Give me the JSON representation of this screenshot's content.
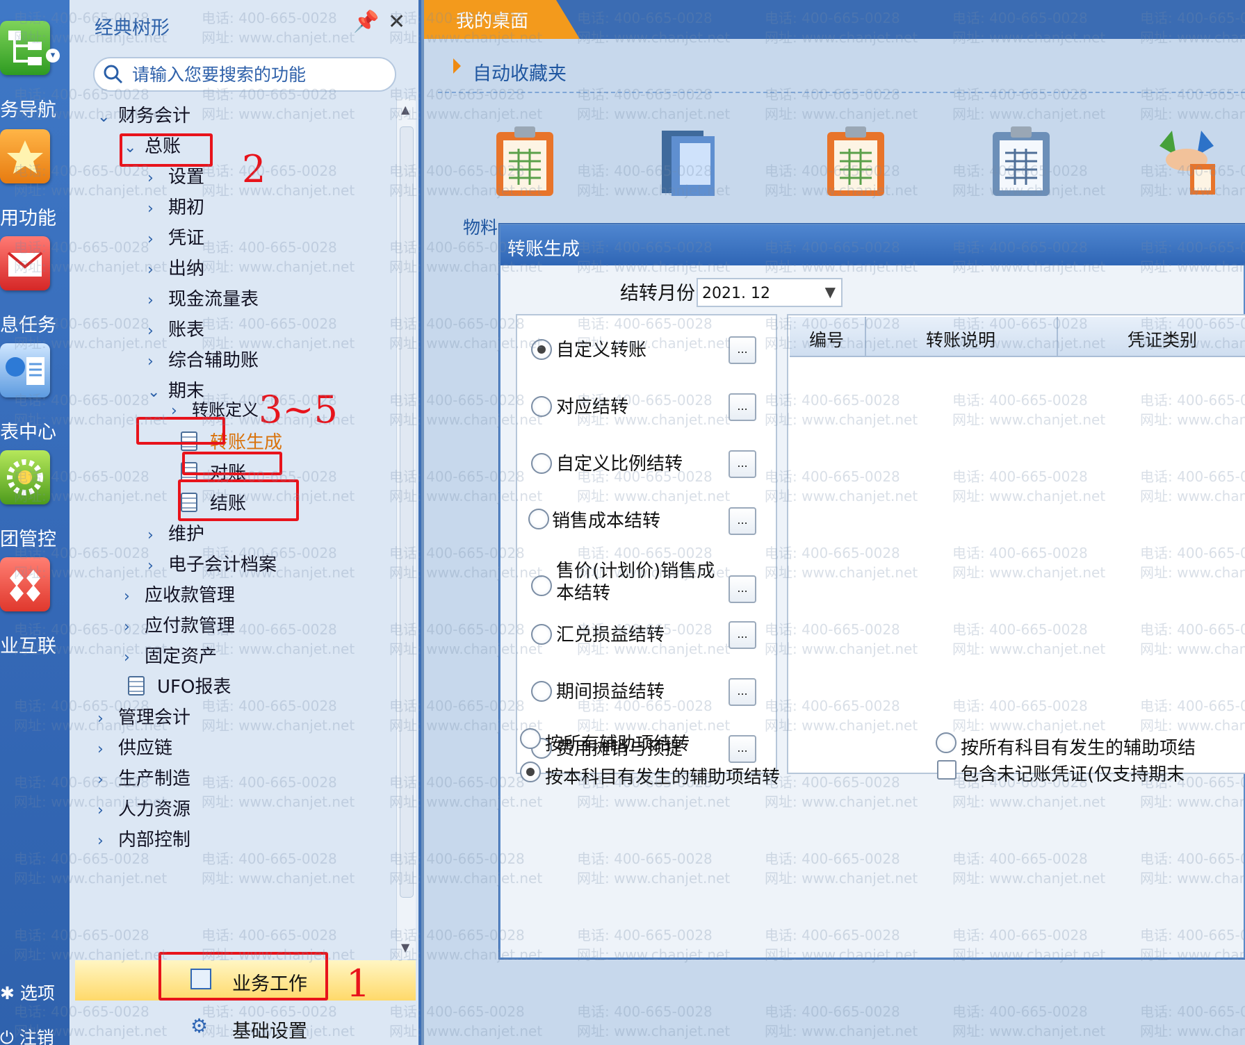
{
  "rail": {
    "items": [
      {
        "label": "务导航",
        "icon": "org-chart-icon"
      },
      {
        "label": "用功能",
        "icon": "star-icon"
      },
      {
        "label": "息任务",
        "icon": "mail-icon"
      },
      {
        "label": "表中心",
        "icon": "report-icon"
      },
      {
        "label": "团管控",
        "icon": "gear-flower-icon"
      },
      {
        "label": "业互联",
        "icon": "diamonds-icon"
      }
    ],
    "options_label": "选项",
    "logout_label": "注销"
  },
  "tree": {
    "title": "经典树形",
    "search_placeholder": "请输入您要搜索的功能",
    "nodes": [
      {
        "label": "财务会计",
        "state": "expanded"
      },
      {
        "label": "总账",
        "state": "expanded"
      },
      {
        "label": "设置",
        "state": "collapsed"
      },
      {
        "label": "期初",
        "state": "collapsed"
      },
      {
        "label": "凭证",
        "state": "collapsed"
      },
      {
        "label": "出纳",
        "state": "collapsed"
      },
      {
        "label": "现金流量表",
        "state": "collapsed"
      },
      {
        "label": "账表",
        "state": "collapsed"
      },
      {
        "label": "综合辅助账",
        "state": "collapsed"
      },
      {
        "label": "期末",
        "state": "expanded"
      },
      {
        "label": "转账定义",
        "state": "collapsed"
      },
      {
        "label": "转账生成",
        "state": "leaf"
      },
      {
        "label": "对账",
        "state": "leaf"
      },
      {
        "label": "结账",
        "state": "leaf"
      },
      {
        "label": "维护",
        "state": "collapsed"
      },
      {
        "label": "电子会计档案",
        "state": "collapsed"
      },
      {
        "label": "应收款管理",
        "state": "collapsed"
      },
      {
        "label": "应付款管理",
        "state": "collapsed"
      },
      {
        "label": "固定资产",
        "state": "collapsed"
      },
      {
        "label": "UFO报表",
        "state": "leaf"
      },
      {
        "label": "管理会计",
        "state": "collapsed"
      },
      {
        "label": "供应链",
        "state": "collapsed"
      },
      {
        "label": "生产制造",
        "state": "collapsed"
      },
      {
        "label": "人力资源",
        "state": "collapsed"
      },
      {
        "label": "内部控制",
        "state": "collapsed"
      }
    ],
    "nav_business": "业务工作",
    "nav_basic": "基础设置"
  },
  "workspace": {
    "tab_label": "我的桌面",
    "favorites_label": "自动收藏夹",
    "desktop_icons": [
      {
        "label": "物料",
        "icon": "clipboard-orange-icon"
      },
      {
        "label": "",
        "icon": "books-icon"
      },
      {
        "label": "",
        "icon": "clipboard-orange-icon"
      },
      {
        "label": "",
        "icon": "clipboard-blue-icon"
      },
      {
        "label": "",
        "icon": "handshake-icon"
      }
    ]
  },
  "dialog": {
    "title": "转账生成",
    "month_label": "结转月份",
    "month_value": "2021. 12",
    "options": [
      {
        "label": "自定义转账",
        "selected": true
      },
      {
        "label": "对应结转",
        "selected": false
      },
      {
        "label": "自定义比例结转",
        "selected": false
      },
      {
        "label": "销售成本结转",
        "selected": false
      },
      {
        "label": "售价(计划价)销售成本结转",
        "line1": "售价(计划价)销售成",
        "line2": "本结转",
        "selected": false
      },
      {
        "label": "汇兑损益结转",
        "selected": false
      },
      {
        "label": "期间损益结转",
        "selected": false
      },
      {
        "label": "费用摊销与预提",
        "selected": false
      }
    ],
    "dots_label": "...",
    "columns": [
      "编号",
      "转账说明",
      "凭证类别"
    ],
    "aux_all": "按所有辅助项结转",
    "aux_subject": "按本科目有发生的辅助项结转",
    "aux_all_subjects": "按所有科目有发生的辅助项结",
    "include_unposted": "包含未记账凭证(仅支持期末",
    "aux_selected": "aux_subject"
  },
  "annotations": {
    "n1": "1",
    "n2": "2",
    "n35": "3~5"
  },
  "watermark": {
    "phone": "电话: 400-665-0028",
    "site": "网址: www.chanjet.net"
  },
  "colors": {
    "accent_orange": "#f39a1c",
    "annotation_red": "#e8131b",
    "rail_blue": "#3468b6"
  }
}
